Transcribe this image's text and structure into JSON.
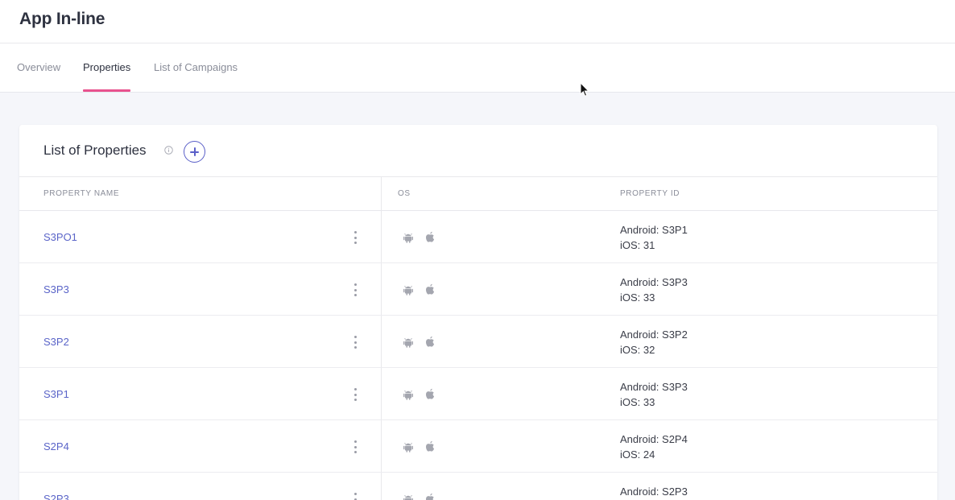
{
  "app": {
    "title": "App In-line"
  },
  "tabs": [
    {
      "label": "Overview",
      "active": false
    },
    {
      "label": "Properties",
      "active": true
    },
    {
      "label": "List of Campaigns",
      "active": false
    }
  ],
  "card": {
    "title": "List of Properties",
    "info_icon": "info-circle-icon",
    "add_icon": "plus-circle-icon"
  },
  "table": {
    "columns": [
      "PROPERTY NAME",
      "OS",
      "PROPERTY ID"
    ],
    "rows": [
      {
        "name": "S3PO1",
        "os": [
          "android-icon",
          "apple-icon"
        ],
        "android_id": "Android: S3P1",
        "ios_id": "iOS: 31"
      },
      {
        "name": "S3P3",
        "os": [
          "android-icon",
          "apple-icon"
        ],
        "android_id": "Android: S3P3",
        "ios_id": "iOS: 33"
      },
      {
        "name": "S3P2",
        "os": [
          "android-icon",
          "apple-icon"
        ],
        "android_id": "Android: S3P2",
        "ios_id": "iOS: 32"
      },
      {
        "name": "S3P1",
        "os": [
          "android-icon",
          "apple-icon"
        ],
        "android_id": "Android: S3P3",
        "ios_id": "iOS: 33"
      },
      {
        "name": "S2P4",
        "os": [
          "android-icon",
          "apple-icon"
        ],
        "android_id": "Android: S2P4",
        "ios_id": "iOS: 24"
      },
      {
        "name": "S2P3",
        "os": [
          "android-icon",
          "apple-icon"
        ],
        "android_id": "Android: S2P3",
        "ios_id": ""
      }
    ]
  },
  "colors": {
    "accent_tab": "#e8528e",
    "link": "#5a64c8",
    "add_button": "#5a5fc8"
  }
}
